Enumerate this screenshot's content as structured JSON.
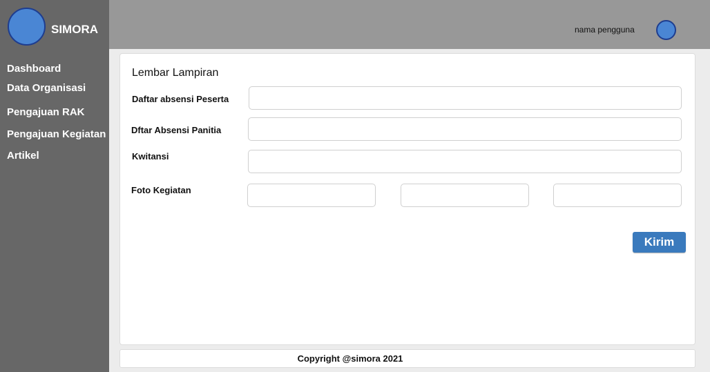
{
  "app": {
    "name": "SIMORA"
  },
  "header": {
    "user_name": "nama pengguna"
  },
  "sidebar": {
    "items": [
      {
        "label": "Dashboard"
      },
      {
        "label": "Data Organisasi"
      },
      {
        "label": "Pengajuan RAK"
      },
      {
        "label": "Pengajuan Kegiatan"
      },
      {
        "label": "Artikel"
      }
    ]
  },
  "form": {
    "title": "Lembar Lampiran",
    "fields": [
      {
        "label": "Daftar absensi Peserta",
        "value": ""
      },
      {
        "label": "Dftar Absensi Panitia",
        "value": ""
      },
      {
        "label": "Kwitansi",
        "value": ""
      },
      {
        "label": "Foto Kegiatan",
        "values": [
          "",
          "",
          ""
        ]
      }
    ],
    "submit_label": "Kirim"
  },
  "footer": {
    "text": "Copyright @simora 2021"
  },
  "colors": {
    "sidebar_bg": "#676767",
    "header_bg": "#989898",
    "accent": "#3a7abd",
    "avatar": "#4a86d4"
  }
}
